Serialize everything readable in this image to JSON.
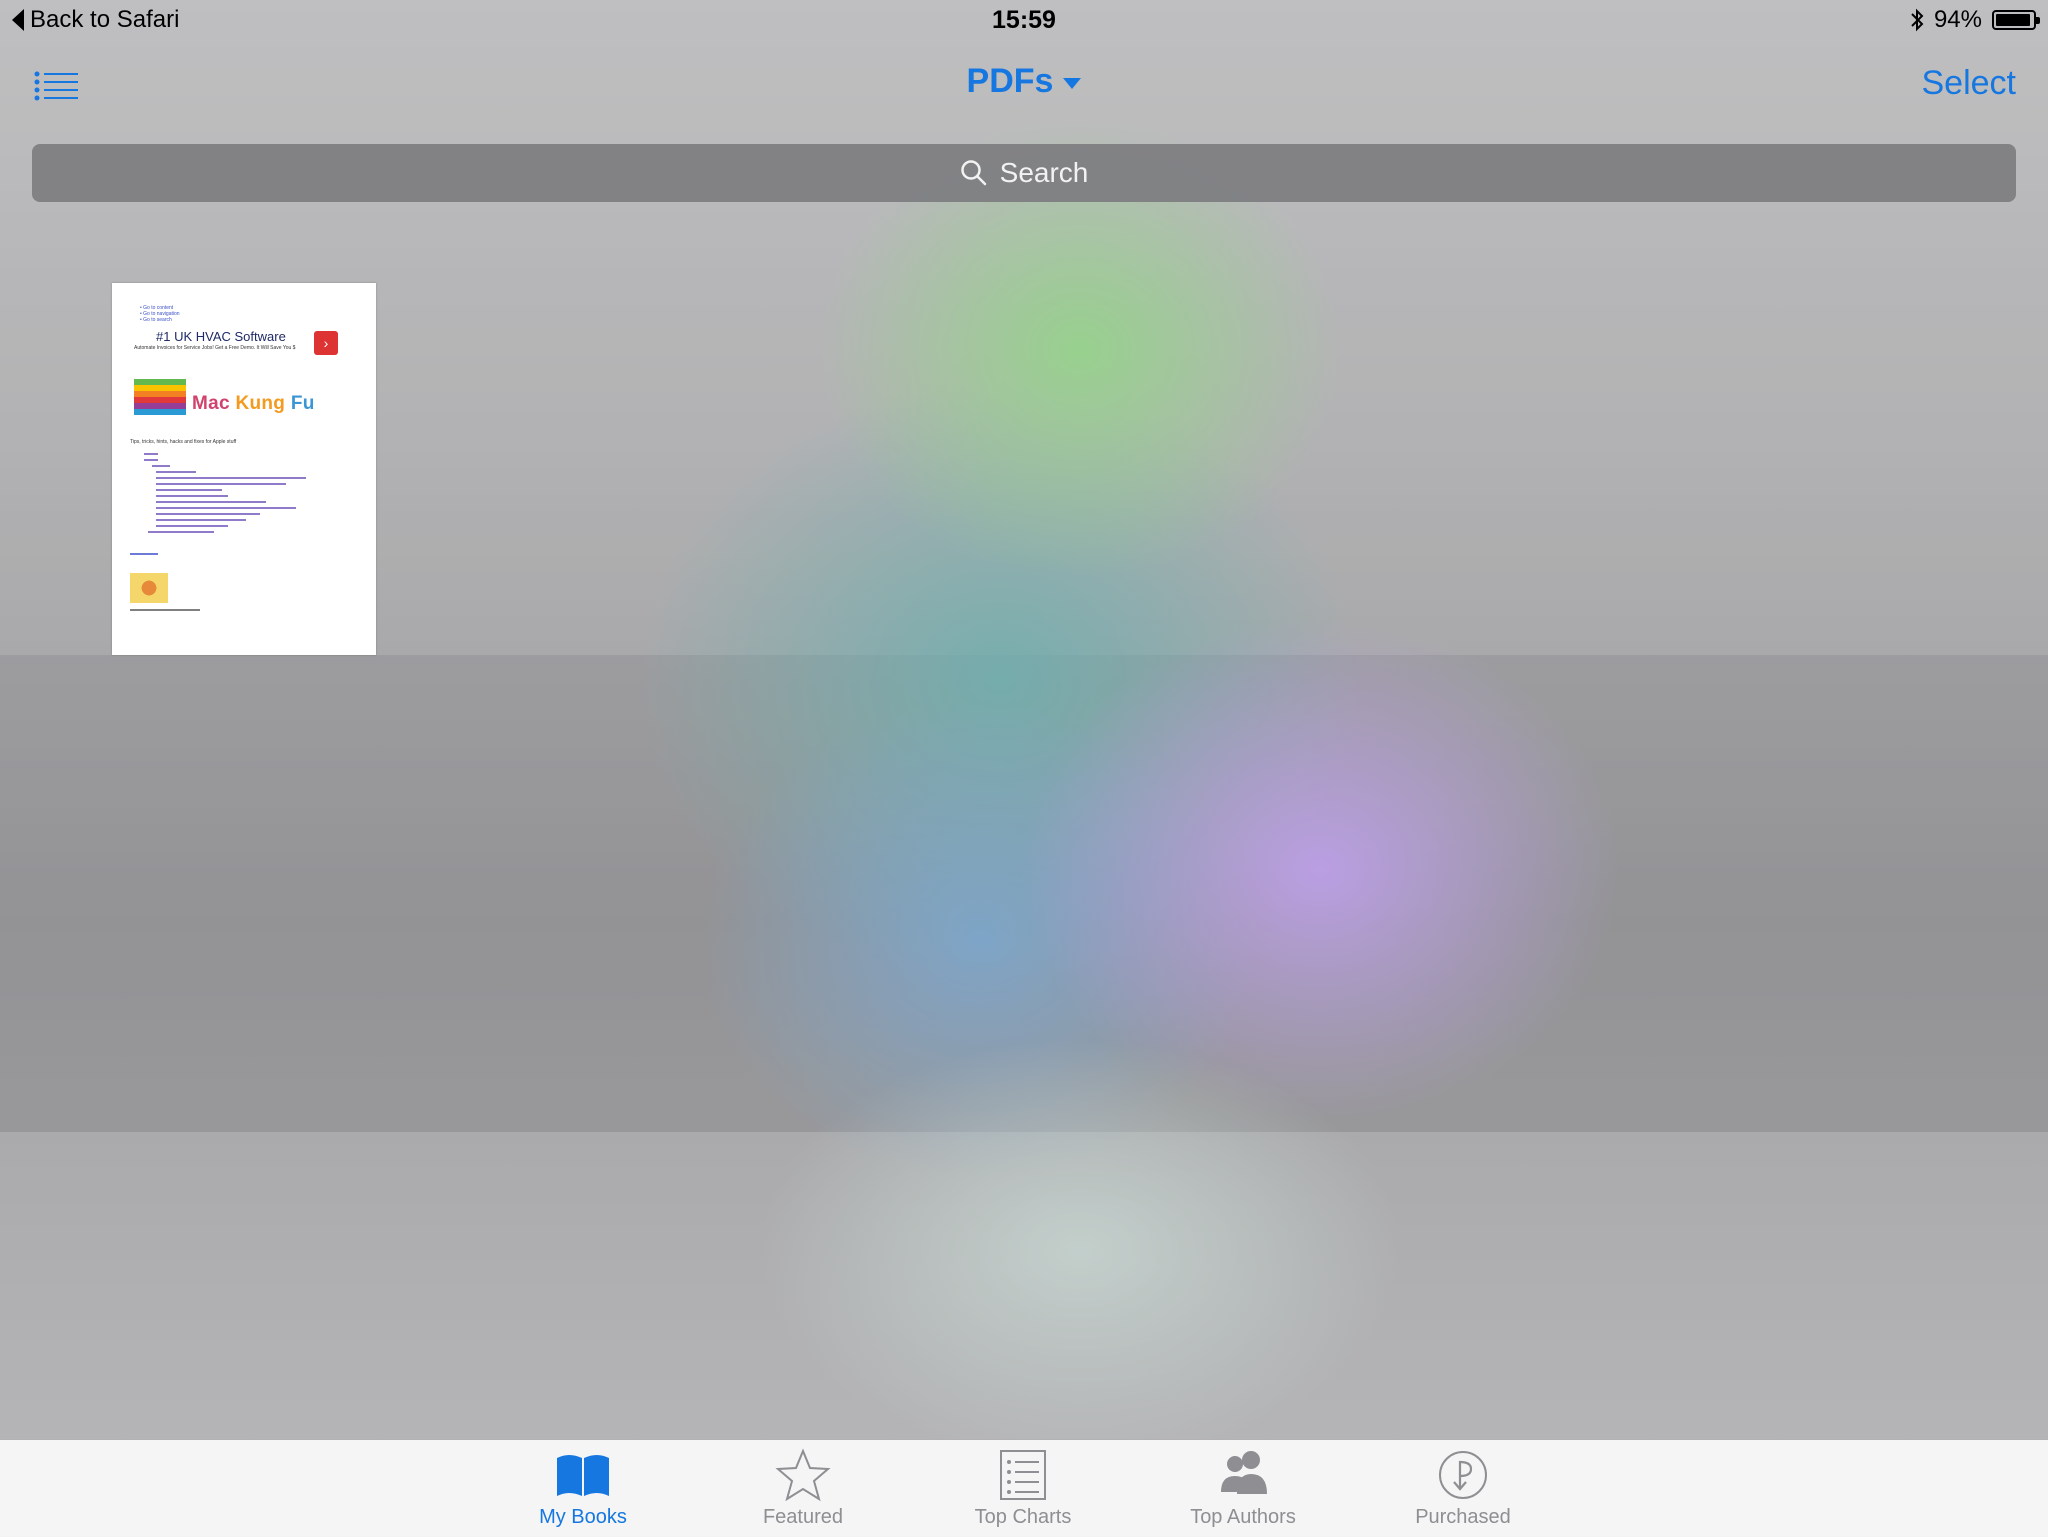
{
  "status_bar": {
    "back_label": "Back to Safari",
    "time": "15:59",
    "battery_percent": "94%",
    "battery_level": 0.94,
    "bluetooth_icon": "bluetooth-icon"
  },
  "nav": {
    "title": "PDFs",
    "select_label": "Select",
    "menu_icon": "list-icon"
  },
  "search": {
    "placeholder": "Search"
  },
  "library": {
    "books": [
      {
        "ad_title": "#1 UK HVAC Software",
        "ad_subtitle": "Automate Invoices for Service Jobs! Get a Free Demo. It Will Save You $",
        "logo_text": [
          "Mac",
          "Kung",
          "Fu"
        ],
        "tagline": "Tips, tricks, hints, hacks and fixes for Apple stuff"
      }
    ]
  },
  "tabbar": {
    "tabs": [
      {
        "label": "My Books",
        "icon": "book-icon",
        "active": true
      },
      {
        "label": "Featured",
        "icon": "star-icon",
        "active": false
      },
      {
        "label": "Top Charts",
        "icon": "list-icon",
        "active": false
      },
      {
        "label": "Top Authors",
        "icon": "authors-icon",
        "active": false
      },
      {
        "label": "Purchased",
        "icon": "purchased-icon",
        "active": false
      }
    ]
  },
  "colors": {
    "accent": "#1677e0",
    "inactive": "#8e8e93"
  }
}
